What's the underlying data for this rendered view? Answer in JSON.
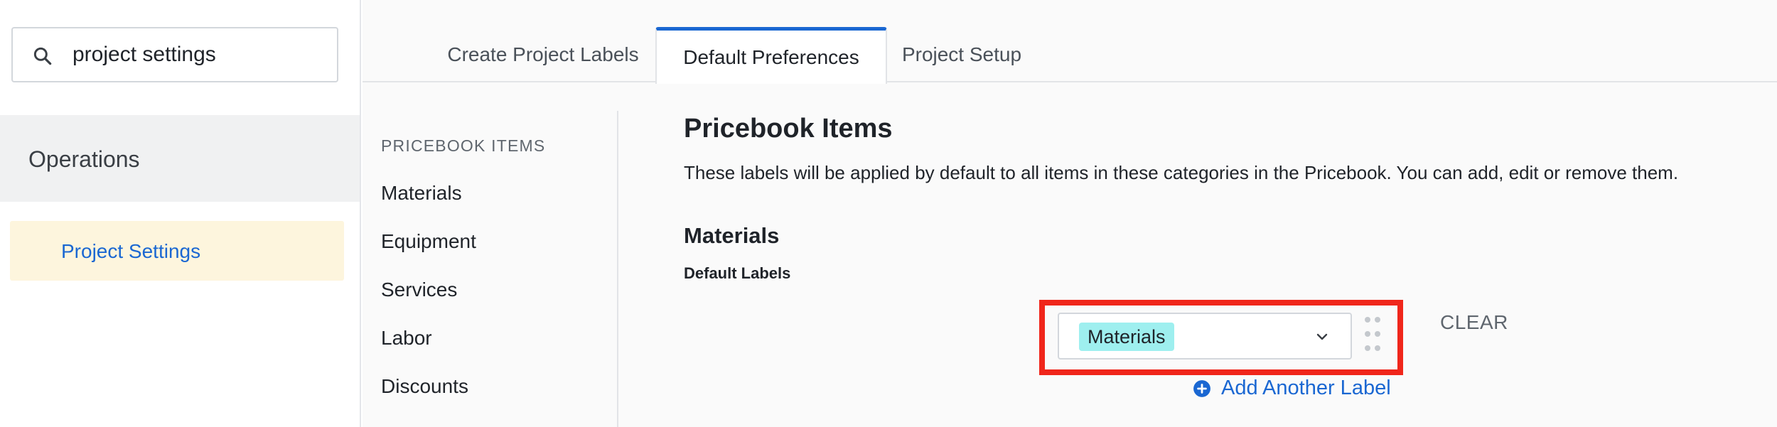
{
  "sidebar": {
    "search": {
      "value": "project settings",
      "placeholder": ""
    },
    "section_label": "Operations",
    "active_item": "Project Settings"
  },
  "tabs": [
    {
      "label": "Create Project Labels",
      "active": false
    },
    {
      "label": "Default Preferences",
      "active": true
    },
    {
      "label": "Project Setup",
      "active": false
    }
  ],
  "subnav": {
    "heading": "PRICEBOOK ITEMS",
    "items": [
      "Materials",
      "Equipment",
      "Services",
      "Labor",
      "Discounts"
    ]
  },
  "content": {
    "title": "Pricebook Items",
    "description": "These labels will be applied by default to all items in these categories in the Pricebook. You can add, edit or remove them.",
    "section_title": "Materials",
    "field_label": "Default Labels",
    "selected_chip": "Materials",
    "clear_label": "CLEAR",
    "add_label": "Add Another Label"
  },
  "colors": {
    "accent": "#1a67d2",
    "highlight": "#f0261b",
    "chip": "#9eefef",
    "active_nav_bg": "#fdf5dd"
  },
  "icons": [
    "search-icon",
    "chevron-down-icon",
    "drag-handle-icon",
    "plus-circle-icon"
  ]
}
